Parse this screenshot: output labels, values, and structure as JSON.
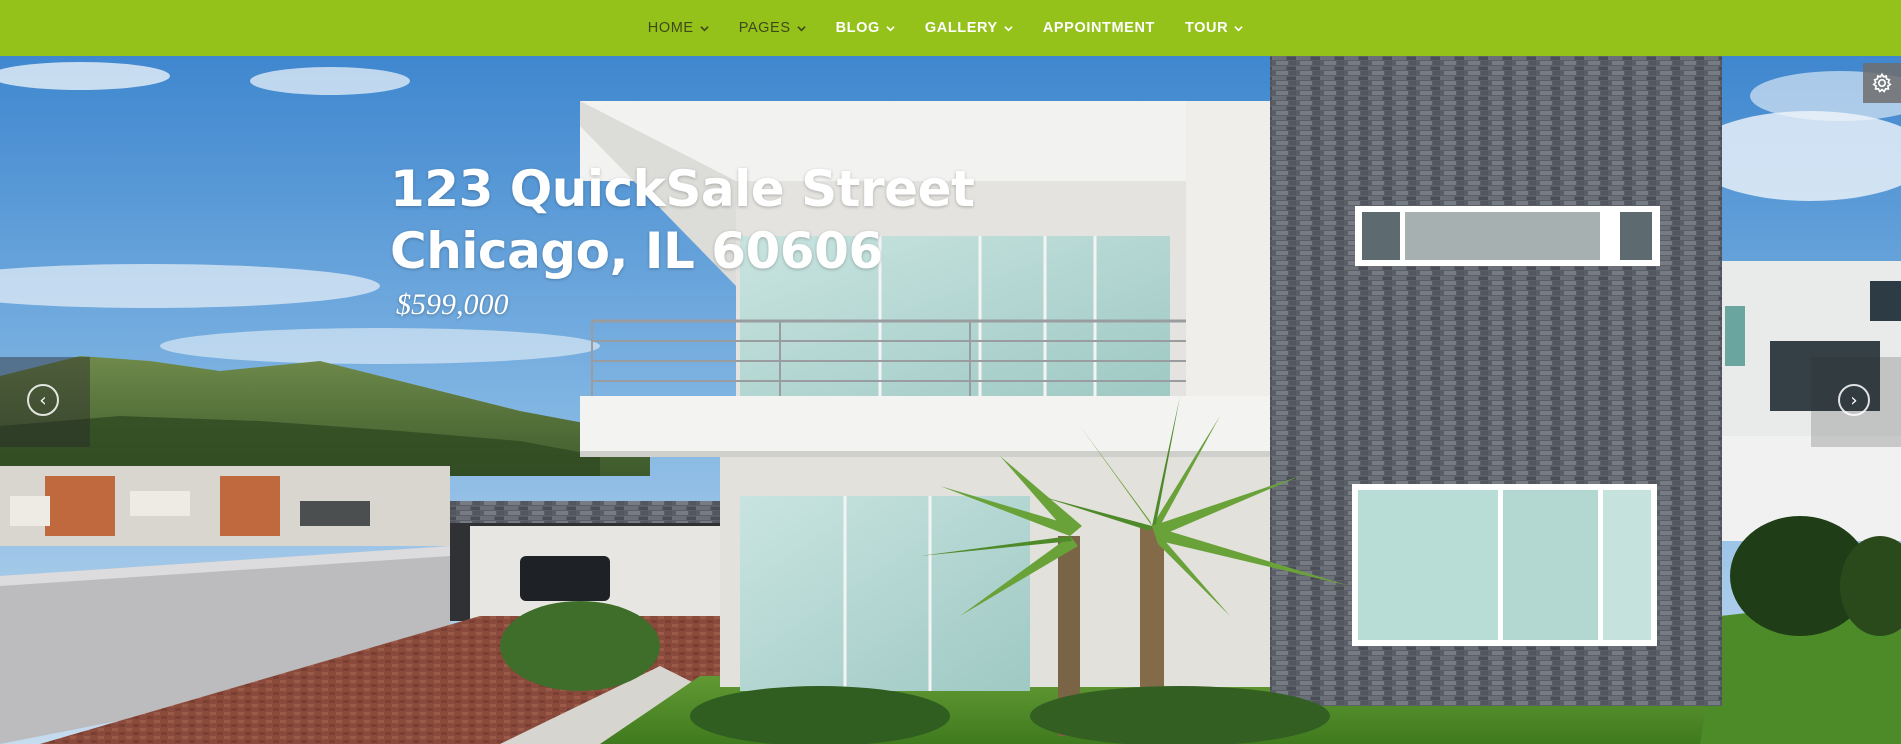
{
  "nav": {
    "items": [
      {
        "label": "HOME",
        "dropdown": true
      },
      {
        "label": "PAGES",
        "dropdown": true
      },
      {
        "label": "BLOG",
        "dropdown": true
      },
      {
        "label": "GALLERY",
        "dropdown": true
      },
      {
        "label": "APPOINTMENT",
        "dropdown": false
      },
      {
        "label": "TOUR",
        "dropdown": true
      }
    ],
    "bar_color": "#94c11a"
  },
  "hero": {
    "address_line1": "123 QuickSale Street",
    "address_line2": "Chicago, IL 60606",
    "price": "$599,000"
  },
  "controls": {
    "prev_icon": "chevron-left-icon",
    "next_icon": "chevron-right-icon",
    "settings_icon": "gear-icon"
  }
}
